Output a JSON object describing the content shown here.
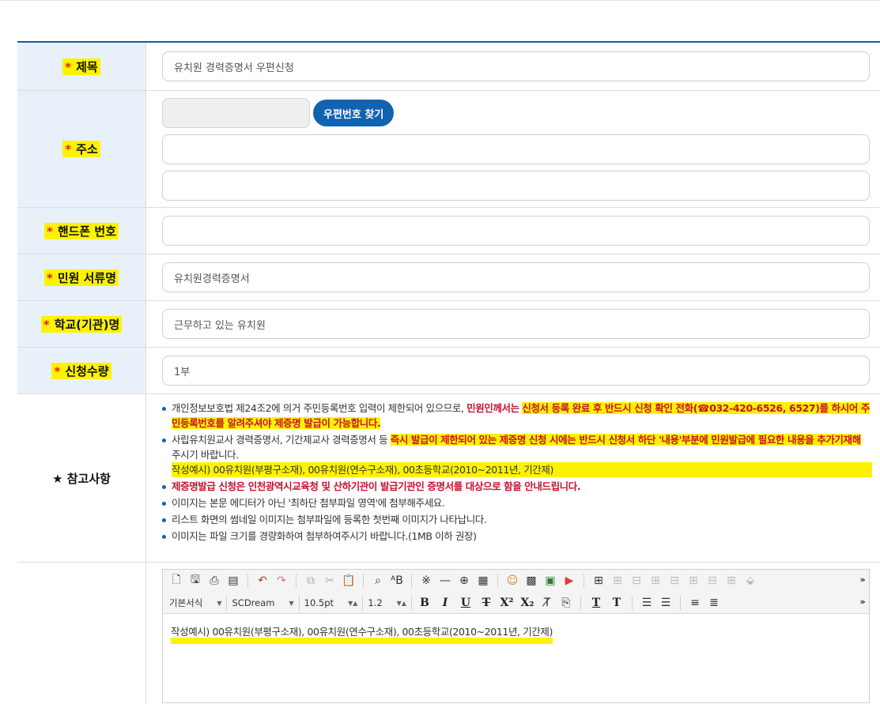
{
  "labels": {
    "title": "제목",
    "address": "주소",
    "phone": "핸드폰 번호",
    "doc_name": "민원 서류명",
    "school": "학교(기관)명",
    "quantity": "신청수량",
    "notes": "★ 참고사항"
  },
  "required_mark": "*",
  "fields": {
    "title_value": "유치원 경력증명서 우편신청",
    "postal_button": "우편번호 찾기",
    "doc_name_value": "유치원경력증명서",
    "school_value": "근무하고 있는 유치원",
    "quantity_value": "1부"
  },
  "notes": {
    "n1_a": "개인정보보호법 제24조2에 의거 주민등록번호 입력이 제한되어 있으므로,",
    "n1_b": "민원인께서는",
    "n1_c": "신청서 등록 완료 후 반드시 신청 확인 전화(☎032-420-6526, 6527)를 하시어 주민등록번호를 알려주셔야 제증명 발급이 가능합니다.",
    "n2_a": "사립유치원교사 경력증명서, 기간제교사 경력증명서 등",
    "n2_b": "즉시 발급이 제한되어 있는 제증명 신청 시에는 반드시 신청서 하단 '내용'부분에 민원발급에 필요한 내용을 추가기재해",
    "n2_c": "주시기 바랍니다.",
    "n2_example": "작성예시) 00유치원(부평구소재), 00유치원(연수구소재), 00초등학교(2010~2011년, 기간제)",
    "n3": "제증명발급 신청은 인천광역시교육청 및 산하기관이 발급기관인 증명서를 대상으로 함을 안내드립니다.",
    "n4": "이미지는 본문 에디터가 아닌 '최하단 첨부파일 영역'에 첨부해주세요.",
    "n5": "리스트 화면의 썸네일 이미지는 첨부파일에 등록한 첫번째 이미지가 나타납니다.",
    "n6": "이미지는 파일 크기를 경량화하여 첨부하여주시기 바랍니다.(1MB 이하 권장)"
  },
  "editor": {
    "style_select": "기본서식",
    "font_select": "SCDream",
    "size_select": "10.5pt",
    "line_height_select": "1.2",
    "more": "»",
    "content": "작성예시) 00유치원(부평구소재), 00유치원(연수구소재), 00초등학교(2010~2011년, 기간제)"
  },
  "colors": {
    "header_line": "#1e5a96",
    "label_bg": "#e8f1f9",
    "button": "#1162b0",
    "highlight": "#fff200",
    "required": "#e2231a",
    "notice_red": "#c8102e"
  }
}
